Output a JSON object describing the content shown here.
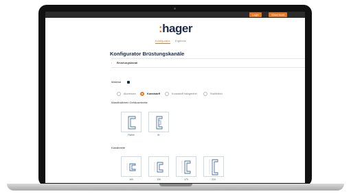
{
  "topbar": {
    "login_label": "Login",
    "cart_label": "Warenkorb"
  },
  "brand": {
    "name": "hager",
    "prefix": ":"
  },
  "tabs": [
    {
      "label": "Konfigurator",
      "active": true
    },
    {
      "label": "Ergebnis",
      "active": false
    }
  ],
  "page_title": "Konfigurator Brüstungskanäle",
  "breadcrumb": {
    "bullet": "›",
    "label": "Brüstungskanal"
  },
  "material": {
    "label": "Material",
    "options": [
      {
        "label": "Aluminium",
        "selected": false
      },
      {
        "label": "Kunststoff",
        "selected": true
      },
      {
        "label": "Kunststoff halogenfrei",
        "selected": false
      },
      {
        "label": "Stahlblech",
        "selected": false
      }
    ]
  },
  "style_section": {
    "label": "Wandhalbinen Gehäusebreite",
    "options": [
      {
        "label": "Rahm"
      },
      {
        "label": "tb"
      }
    ]
  },
  "size_section": {
    "label": "Kanalbreite",
    "options": [
      {
        "label": "100"
      },
      {
        "label": "130"
      },
      {
        "label": "170"
      },
      {
        "label": "210"
      }
    ]
  },
  "colors": {
    "accent": "#e87722",
    "brand": "#1c2a4a",
    "card_border": "#cfd8e3",
    "diagram": "#4a6fa5"
  }
}
